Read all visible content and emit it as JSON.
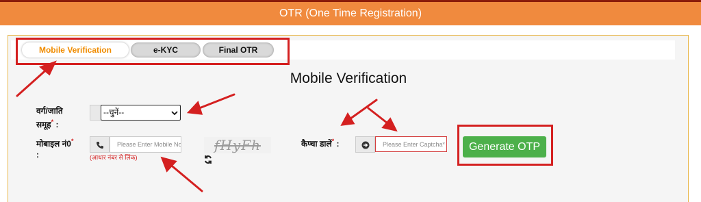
{
  "header": {
    "title": "OTR (One Time Registration)"
  },
  "tabs": [
    {
      "label": "Mobile Verification",
      "active": true
    },
    {
      "label": "e-KYC",
      "active": false
    },
    {
      "label": "Final OTR",
      "active": false
    }
  ],
  "form": {
    "title": "Mobile Verification",
    "category_label": "वर्ग/जाति समूह",
    "category_required": "*",
    "category_colon": ":",
    "category_selected": "--चुनें--",
    "mobile_label": "मोबाइल नं0",
    "mobile_required": "*",
    "mobile_colon": ":",
    "mobile_placeholder": "Please Enter Mobile No.",
    "mobile_hint": "(आधार नंबर से लिंक)",
    "captcha_label": "कैप्चा डालें",
    "captcha_required": "*",
    "captcha_colon": ":",
    "captcha_text": "fHyFh",
    "captcha_placeholder": "Please Enter Captcha*",
    "generate_button": "Generate OTP"
  },
  "icons": {
    "phone": "phone-icon",
    "arrow_circle": "arrow-circle-icon",
    "refresh": "refresh-icon",
    "dropdown": "chevron-down-icon"
  },
  "colors": {
    "header_bg": "#f08a3e",
    "active_tab_text": "#f08c00",
    "button_green": "#4cb04a",
    "annotation_red": "#d42020"
  }
}
